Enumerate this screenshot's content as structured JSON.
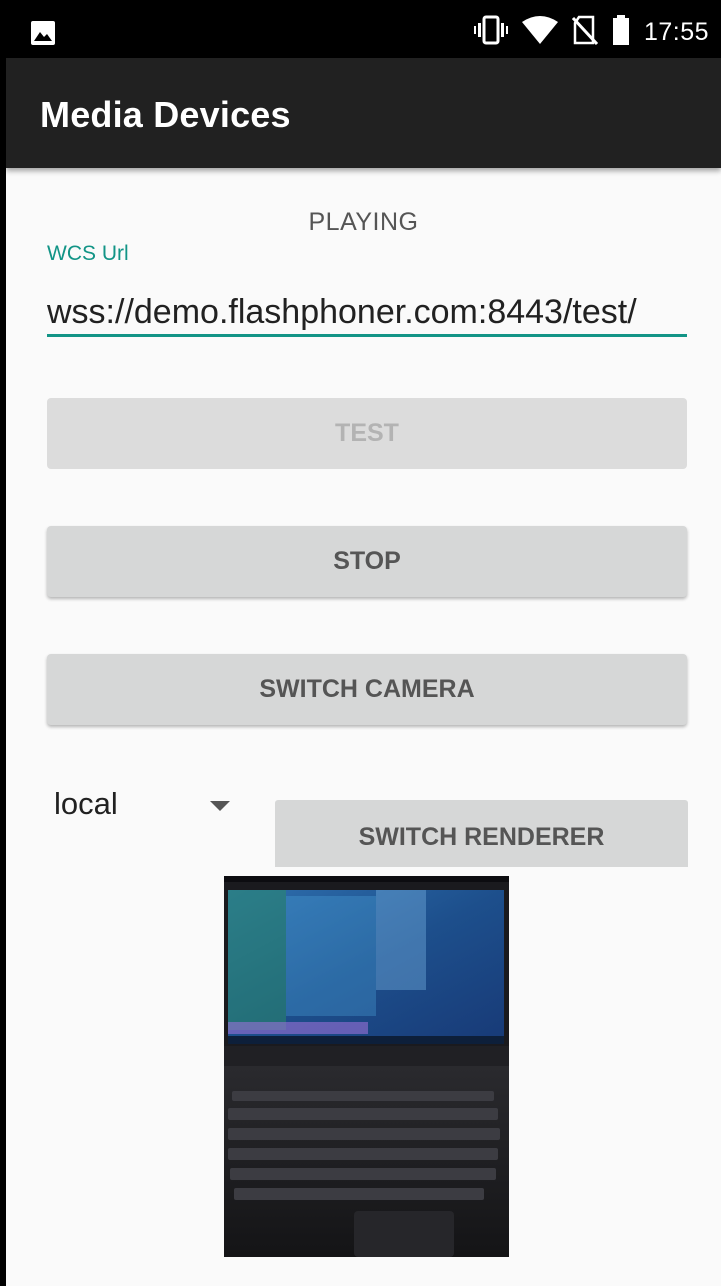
{
  "status_bar": {
    "time": "17:55",
    "icons": [
      "image-icon",
      "vibrate-icon",
      "wifi-icon",
      "no-sim-icon",
      "battery-icon"
    ]
  },
  "app_bar": {
    "title": "Media Devices"
  },
  "main": {
    "status": "PLAYING",
    "url_label": "WCS Url",
    "url_value": "wss://demo.flashphoner.com:8443/test/",
    "test_button": "TEST",
    "stop_button": "STOP",
    "switch_camera_button": "SWITCH CAMERA",
    "renderer_select": "local",
    "switch_renderer_button": "SWITCH RENDERER"
  },
  "colors": {
    "accent": "#129486",
    "app_bar": "#212121",
    "button": "#d6d7d7"
  }
}
